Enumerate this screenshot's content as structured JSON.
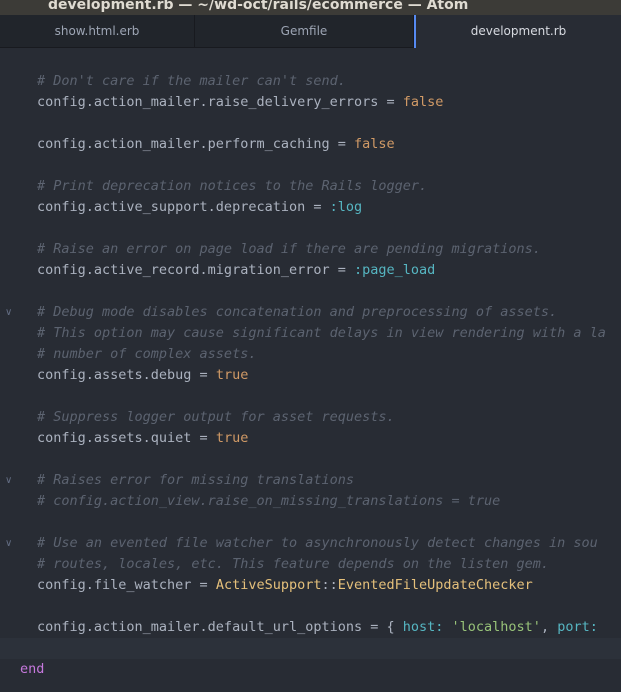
{
  "window": {
    "title": "development.rb — ~/wd-oct/rails/ecommerce — Atom"
  },
  "tabs": [
    {
      "label": "show.html.erb",
      "active": false
    },
    {
      "label": "Gemfile",
      "active": false
    },
    {
      "label": "development.rb",
      "active": true
    }
  ],
  "colors": {
    "background": "#282c34",
    "comment": "#5c6370",
    "text": "#abb2bf",
    "boolean": "#d19a66",
    "symbol": "#56b6c2",
    "constant": "#e5c07b",
    "keyword": "#c678dd",
    "string": "#98c379",
    "active_tab_accent": "#568af2"
  },
  "editor": {
    "lines": [
      {
        "comment": "# Don't care if the mailer can't send."
      },
      {
        "text": "config.action_mailer.raise_delivery_errors = ",
        "bool": "false"
      },
      {
        "text": "config.action_mailer.perform_caching = ",
        "bool": "false"
      },
      {
        "comment": "# Print deprecation notices to the Rails logger."
      },
      {
        "text": "config.active_support.deprecation = ",
        "sym": ":log"
      },
      {
        "comment": "# Raise an error on page load if there are pending migrations."
      },
      {
        "text": "config.active_record.migration_error = ",
        "sym": ":page_load"
      },
      {
        "comment": "# Debug mode disables concatenation and preprocessing of assets.",
        "fold": "chevron-down-icon"
      },
      {
        "comment": "# This option may cause significant delays in view rendering with a la"
      },
      {
        "comment": "# number of complex assets."
      },
      {
        "text": "config.assets.debug = ",
        "bool": "true"
      },
      {
        "comment": "# Suppress logger output for asset requests."
      },
      {
        "text": "config.assets.quiet = ",
        "bool": "true"
      },
      {
        "comment": "# Raises error for missing translations",
        "fold": "chevron-down-icon"
      },
      {
        "comment": "# config.action_view.raise_on_missing_translations = true"
      },
      {
        "comment": "# Use an evented file watcher to asynchronously detect changes in sou",
        "fold": "chevron-down-icon"
      },
      {
        "comment": "# routes, locales, etc. This feature depends on the listen gem."
      },
      {
        "text": "config.file_watcher = ",
        "const1": "ActiveSupport",
        "sep": "::",
        "const2": "EventedFileUpdateChecker"
      },
      {
        "text": "config.action_mailer.default_url_options = { ",
        "sym1": "host:",
        "sp1": " ",
        "str": "'localhost'",
        "sp2": ", ",
        "sym2": "port:"
      },
      {
        "keyword": "end"
      }
    ]
  }
}
